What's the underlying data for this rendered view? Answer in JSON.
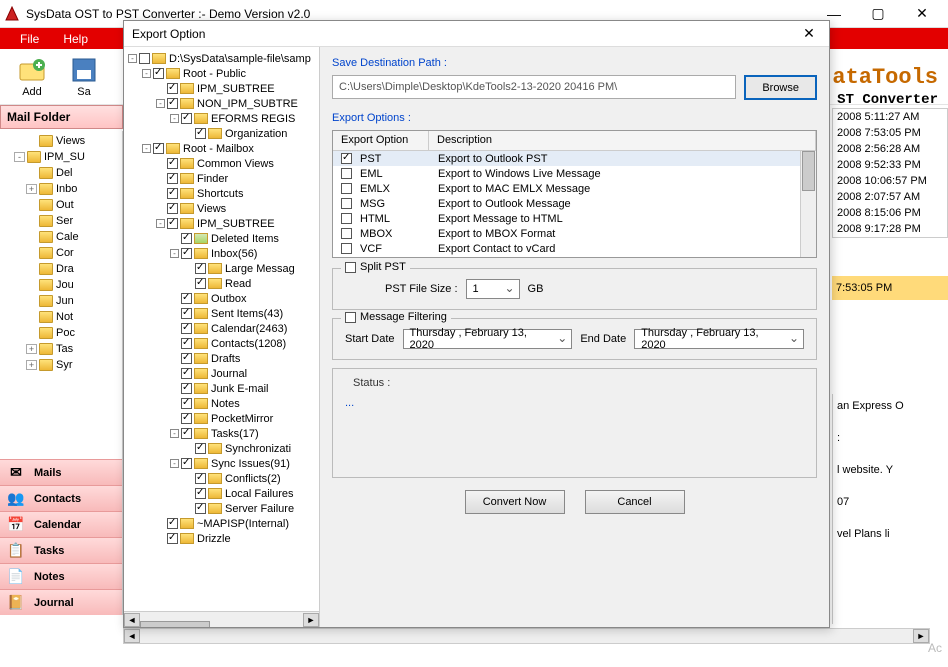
{
  "window": {
    "title": "SysData OST to PST Converter :- Demo Version v2.0",
    "min": "—",
    "max": "▢",
    "close": "✕"
  },
  "menu": {
    "file": "File",
    "help": "Help"
  },
  "toolbar": {
    "add": "Add",
    "save": "Sa"
  },
  "brand": {
    "name": "ataTools",
    "sub": "ST Converter"
  },
  "mail_folder_label": "Mail Folder",
  "left_tree": [
    {
      "ind": 2,
      "exp": "",
      "label": "Views"
    },
    {
      "ind": 1,
      "exp": "-",
      "label": "IPM_SU"
    },
    {
      "ind": 2,
      "exp": "",
      "label": "Del"
    },
    {
      "ind": 2,
      "exp": "+",
      "label": "Inbo"
    },
    {
      "ind": 2,
      "exp": "",
      "label": "Out"
    },
    {
      "ind": 2,
      "exp": "",
      "label": "Ser"
    },
    {
      "ind": 2,
      "exp": "",
      "label": "Cale"
    },
    {
      "ind": 2,
      "exp": "",
      "label": "Cor"
    },
    {
      "ind": 2,
      "exp": "",
      "label": "Dra"
    },
    {
      "ind": 2,
      "exp": "",
      "label": "Jou"
    },
    {
      "ind": 2,
      "exp": "",
      "label": "Jun"
    },
    {
      "ind": 2,
      "exp": "",
      "label": "Not"
    },
    {
      "ind": 2,
      "exp": "",
      "label": "Poc"
    },
    {
      "ind": 2,
      "exp": "+",
      "label": "Tas"
    },
    {
      "ind": 2,
      "exp": "+",
      "label": "Syr"
    }
  ],
  "nav": [
    {
      "icon": "✉",
      "label": "Mails"
    },
    {
      "icon": "👥",
      "label": "Contacts"
    },
    {
      "icon": "📅",
      "label": "Calendar"
    },
    {
      "icon": "📋",
      "label": "Tasks"
    },
    {
      "icon": "📄",
      "label": "Notes"
    },
    {
      "icon": "📔",
      "label": "Journal"
    }
  ],
  "dialog": {
    "title": "Export Option",
    "save_dest_label": "Save Destination Path :",
    "path_value": "C:\\Users\\Dimple\\Desktop\\KdeTools2-13-2020 20416 PM\\",
    "browse": "Browse",
    "export_opts_label": "Export Options :",
    "opt_hdr": {
      "c1": "Export Option",
      "c2": "Description"
    },
    "options": [
      {
        "k": "PST",
        "d": "Export to Outlook PST",
        "ck": true,
        "sel": true
      },
      {
        "k": "EML",
        "d": "Export to Windows Live Message",
        "ck": false
      },
      {
        "k": "EMLX",
        "d": "Export to MAC EMLX Message",
        "ck": false
      },
      {
        "k": "MSG",
        "d": "Export to Outlook Message",
        "ck": false
      },
      {
        "k": "HTML",
        "d": "Export Message to HTML",
        "ck": false
      },
      {
        "k": "MBOX",
        "d": "Export to MBOX Format",
        "ck": false
      },
      {
        "k": "VCF",
        "d": "Export Contact to vCard",
        "ck": false
      }
    ],
    "split_pst": "Split PST",
    "pst_size_lbl": "PST File Size :",
    "pst_size_val": "1",
    "pst_size_unit": "GB",
    "msg_filter": "Message Filtering",
    "start_date_lbl": "Start Date",
    "start_date_val": "Thursday ,  February   13, 2020",
    "end_date_lbl": "End Date",
    "end_date_val": "Thursday ,  February   13, 2020",
    "status_lbl": "Status :",
    "status_val": "...",
    "convert": "Convert Now",
    "cancel": "Cancel"
  },
  "dlg_tree": [
    {
      "ind": 0,
      "exp": "-",
      "cb": "p",
      "label": "D:\\SysData\\sample-file\\samp"
    },
    {
      "ind": 1,
      "exp": "-",
      "cb": "c",
      "label": "Root - Public"
    },
    {
      "ind": 2,
      "exp": "",
      "cb": "c",
      "label": "IPM_SUBTREE"
    },
    {
      "ind": 2,
      "exp": "-",
      "cb": "c",
      "label": "NON_IPM_SUBTRE"
    },
    {
      "ind": 3,
      "exp": "-",
      "cb": "c",
      "label": "EFORMS REGIS"
    },
    {
      "ind": 4,
      "exp": "",
      "cb": "c",
      "label": "Organization"
    },
    {
      "ind": 1,
      "exp": "-",
      "cb": "c",
      "label": "Root - Mailbox"
    },
    {
      "ind": 2,
      "exp": "",
      "cb": "c",
      "label": "Common Views"
    },
    {
      "ind": 2,
      "exp": "",
      "cb": "c",
      "label": "Finder"
    },
    {
      "ind": 2,
      "exp": "",
      "cb": "c",
      "label": "Shortcuts"
    },
    {
      "ind": 2,
      "exp": "",
      "cb": "c",
      "label": "Views"
    },
    {
      "ind": 2,
      "exp": "-",
      "cb": "c",
      "label": "IPM_SUBTREE"
    },
    {
      "ind": 3,
      "exp": "",
      "cb": "c",
      "label": "Deleted Items",
      "del": true
    },
    {
      "ind": 3,
      "exp": "-",
      "cb": "c",
      "label": "Inbox(56)"
    },
    {
      "ind": 4,
      "exp": "",
      "cb": "c",
      "label": "Large Messag"
    },
    {
      "ind": 4,
      "exp": "",
      "cb": "c",
      "label": "Read"
    },
    {
      "ind": 3,
      "exp": "",
      "cb": "c",
      "label": "Outbox"
    },
    {
      "ind": 3,
      "exp": "",
      "cb": "c",
      "label": "Sent Items(43)"
    },
    {
      "ind": 3,
      "exp": "",
      "cb": "c",
      "label": "Calendar(2463)"
    },
    {
      "ind": 3,
      "exp": "",
      "cb": "c",
      "label": "Contacts(1208)"
    },
    {
      "ind": 3,
      "exp": "",
      "cb": "c",
      "label": "Drafts"
    },
    {
      "ind": 3,
      "exp": "",
      "cb": "c",
      "label": "Journal"
    },
    {
      "ind": 3,
      "exp": "",
      "cb": "c",
      "label": "Junk E-mail"
    },
    {
      "ind": 3,
      "exp": "",
      "cb": "c",
      "label": "Notes"
    },
    {
      "ind": 3,
      "exp": "",
      "cb": "c",
      "label": "PocketMirror"
    },
    {
      "ind": 3,
      "exp": "-",
      "cb": "c",
      "label": "Tasks(17)"
    },
    {
      "ind": 4,
      "exp": "",
      "cb": "c",
      "label": "Synchronizati"
    },
    {
      "ind": 3,
      "exp": "-",
      "cb": "c",
      "label": "Sync Issues(91)"
    },
    {
      "ind": 4,
      "exp": "",
      "cb": "c",
      "label": "Conflicts(2)"
    },
    {
      "ind": 4,
      "exp": "",
      "cb": "c",
      "label": "Local Failures"
    },
    {
      "ind": 4,
      "exp": "",
      "cb": "c",
      "label": "Server Failure"
    },
    {
      "ind": 2,
      "exp": "",
      "cb": "c",
      "label": "~MAPISP(Internal)"
    },
    {
      "ind": 2,
      "exp": "",
      "cb": "c",
      "label": "Drizzle"
    }
  ],
  "right_strip": [
    "2008 5:11:27 AM",
    "2008 7:53:05 PM",
    "2008 2:56:28 AM",
    "2008 9:52:33 PM",
    "2008 10:06:57 PM",
    "2008 2:07:57 AM",
    "2008 8:15:06 PM",
    "2008 9:17:28 PM"
  ],
  "right_hl": "7:53:05 PM",
  "preview": {
    "l1": "an Express O",
    "l2": ":",
    "l3": "l website. Y",
    "l4": "07",
    "l5": "vel Plans li"
  },
  "activate": "Ac"
}
